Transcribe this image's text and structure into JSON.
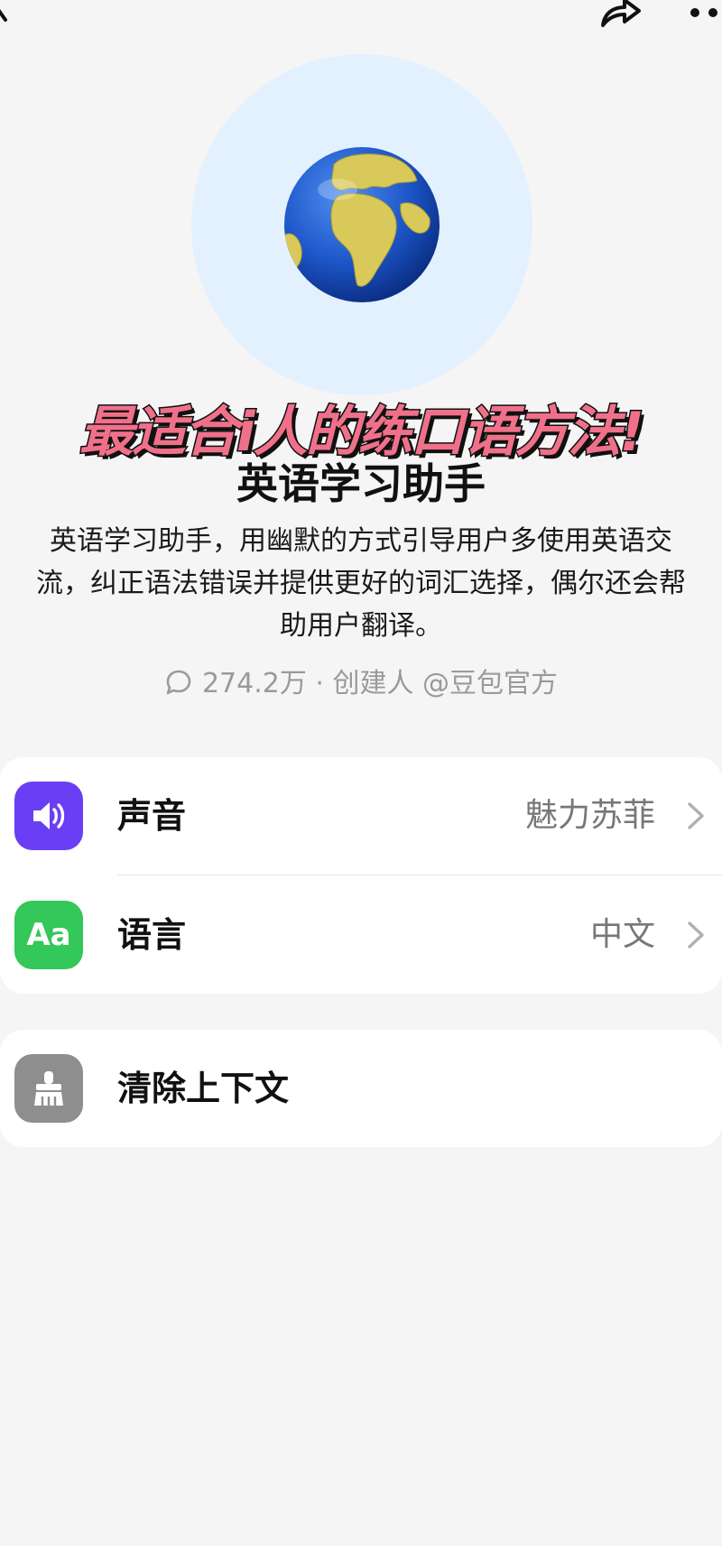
{
  "header": {
    "back_icon": "back-arrow-icon",
    "share_icon": "share-icon",
    "more_icon": "more-dots-icon"
  },
  "profile": {
    "avatar_icon": "globe-icon",
    "avatar_bg": "#e3f0fe",
    "promo_caption": "最适合i人的练口语方法!",
    "promo_color": "#f0708a",
    "title": "英语学习助手",
    "description": "英语学习助手，用幽默的方式引导用户多使用英语交流，纠正语法错误并提供更好的词汇选择，偶尔还会帮助用户翻译。",
    "chat_count": "274.2万",
    "separator": "·",
    "creator": "创建人 @豆包官方"
  },
  "settings": [
    {
      "label": "声音",
      "value": "魅力苏菲",
      "icon": "speaker-icon",
      "icon_bg": "#6a3ef5"
    },
    {
      "label": "语言",
      "value": "中文",
      "icon": "text-aa-icon",
      "icon_text": "Aa",
      "icon_bg": "#34c759"
    }
  ],
  "actions": [
    {
      "label": "清除上下文",
      "icon": "broom-icon",
      "icon_bg": "#8e8e8e"
    }
  ]
}
